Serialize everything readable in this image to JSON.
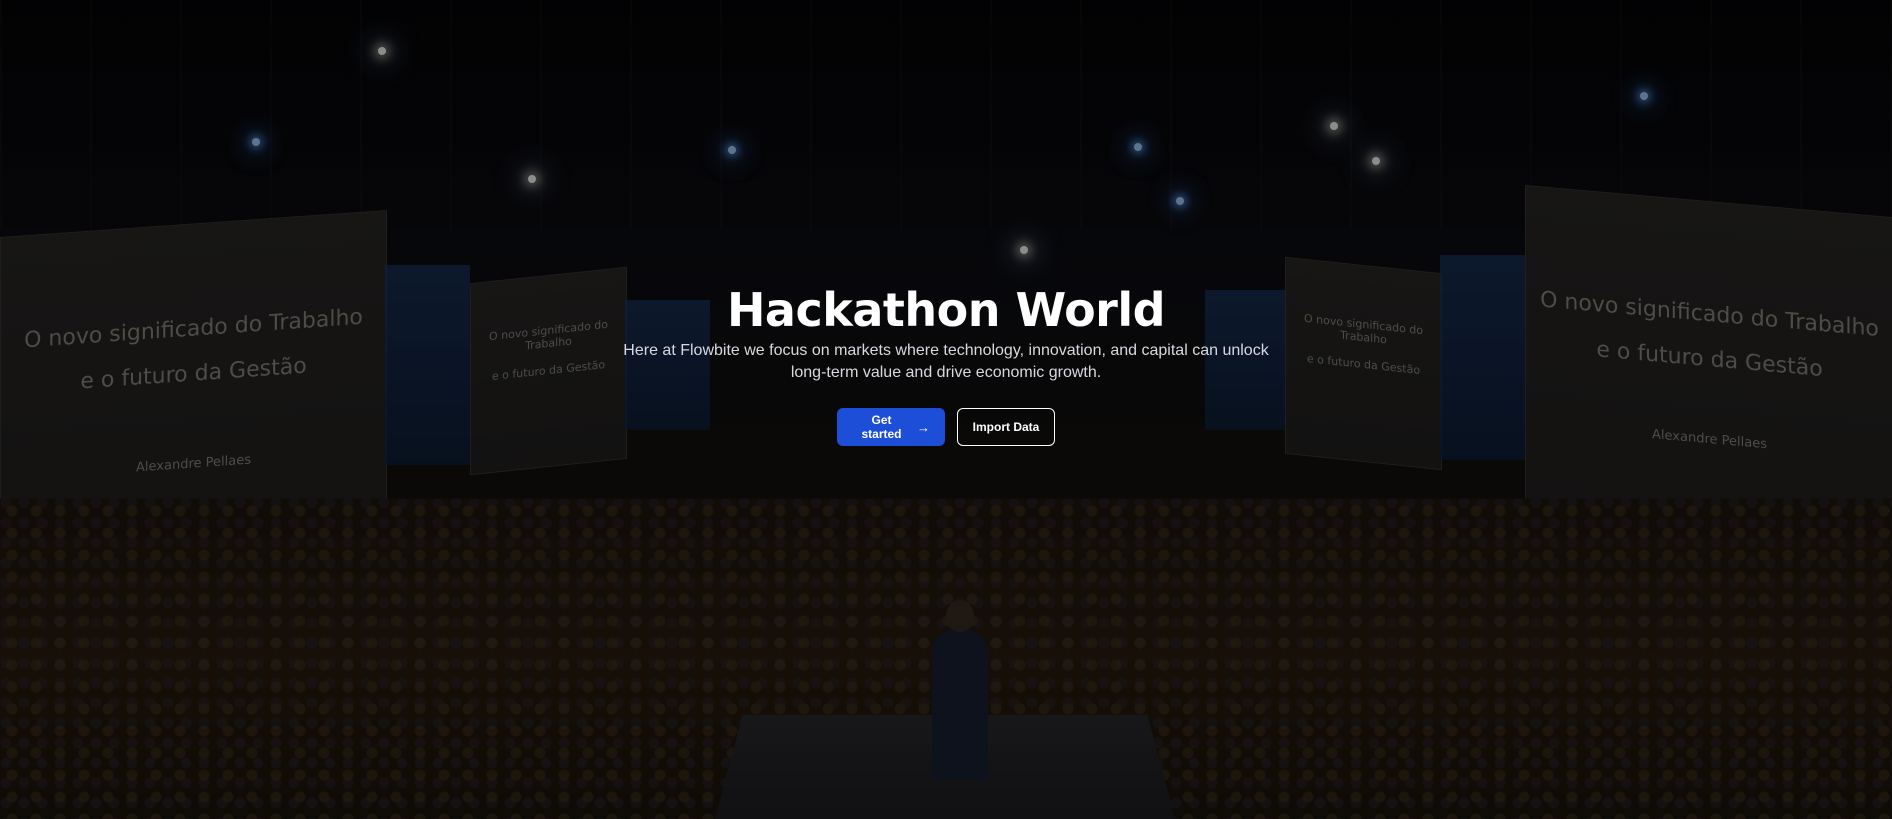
{
  "hero": {
    "title": "Hackathon World",
    "subtitle": "Here at Flowbite we focus on markets where technology, innovation, and capital can unlock long-term value and drive economic growth.",
    "primary_button": {
      "label": "Get started",
      "icon": "arrow-right-icon",
      "color": "#1d4ed8"
    },
    "secondary_button": {
      "label": "Import Data"
    }
  },
  "background": {
    "screen_text_line1": "O novo significado do Trabalho",
    "screen_text_line2": "e o futuro da Gestão",
    "screen_presenter": "Alexandre Pellaes"
  }
}
